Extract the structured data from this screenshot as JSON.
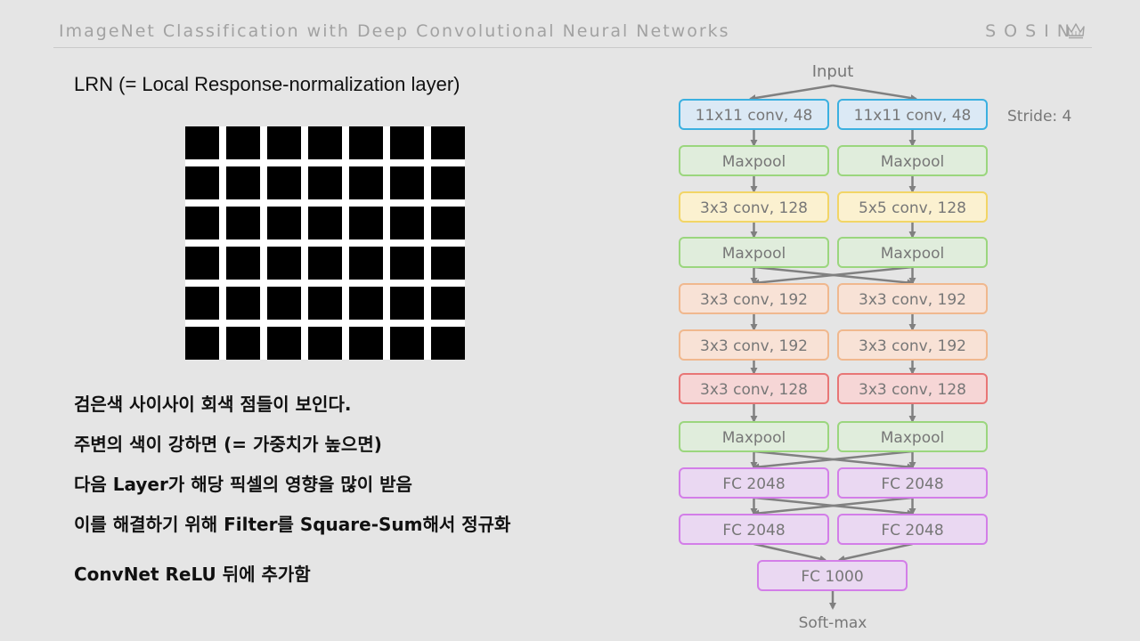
{
  "header": {
    "title": "ImageNet Classification with Deep Convolutional Neural Networks",
    "brand": "SOSIN",
    "brand_icon": "crown-icon"
  },
  "section": {
    "title": "LRN (= Local Response-normalization layer)"
  },
  "illusion": {
    "rows": 6,
    "cols": 7,
    "square_color": "#000000",
    "gap_color": "#ffffff"
  },
  "notes": [
    "검은색 사이사이 회색 점들이 보인다.",
    "주변의 색이 강하면 (= 가중치가 높으면)",
    "다음 Layer가 해당 픽셀의 영향을 많이 받음",
    "이를 해결하기 위해 Filter를 Square-Sum해서 정규화",
    "ConvNet ReLU 뒤에 추가함"
  ],
  "architecture": {
    "input_label": "Input",
    "stride_label": "Stride: 4",
    "output_label": "Soft-max",
    "layers": [
      {
        "left": "11x11 conv, 48",
        "right": "11x11 conv, 48",
        "fill": "#dbe9f5",
        "stroke": "#3bb0e0"
      },
      {
        "left": "Maxpool",
        "right": "Maxpool",
        "fill": "#e0eddc",
        "stroke": "#9bd67e"
      },
      {
        "left": "3x3 conv, 128",
        "right": "5x5 conv, 128",
        "fill": "#fbf1d0",
        "stroke": "#f2d566"
      },
      {
        "left": "Maxpool",
        "right": "Maxpool",
        "fill": "#e0eddc",
        "stroke": "#9bd67e"
      },
      {
        "left": "3x3 conv, 192",
        "right": "3x3 conv, 192",
        "fill": "#f8e2d6",
        "stroke": "#f0b88e"
      },
      {
        "left": "3x3 conv, 192",
        "right": "3x3 conv, 192",
        "fill": "#f8e2d6",
        "stroke": "#f0b88e"
      },
      {
        "left": "3x3 conv, 128",
        "right": "3x3 conv, 128",
        "fill": "#f6d6d6",
        "stroke": "#e87676"
      },
      {
        "left": "Maxpool",
        "right": "Maxpool",
        "fill": "#e0eddc",
        "stroke": "#9bd67e"
      },
      {
        "left": "FC 2048",
        "right": "FC 2048",
        "fill": "#ead8f2",
        "stroke": "#d37ee8"
      },
      {
        "left": "FC 2048",
        "right": "FC 2048",
        "fill": "#ead8f2",
        "stroke": "#d37ee8"
      }
    ],
    "final_layer": {
      "label": "FC 1000",
      "fill": "#ead8f2",
      "stroke": "#d37ee8"
    },
    "arrow_color": "#808080"
  }
}
